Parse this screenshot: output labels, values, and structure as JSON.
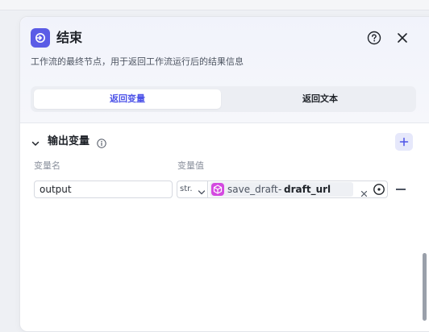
{
  "node": {
    "title": "结束",
    "description": "工作流的最终节点，用于返回工作流运行后的结果信息"
  },
  "tabs": [
    {
      "label": "返回变量",
      "active": true
    },
    {
      "label": "返回文本",
      "active": false
    }
  ],
  "output_section": {
    "title": "输出变量",
    "columns": {
      "name": "变量名",
      "value": "变量值"
    },
    "rows": [
      {
        "name": "output",
        "type": "str.",
        "ref_node": "save_draft",
        "ref_sep": "-",
        "ref_field": "draft_url"
      }
    ]
  },
  "colors": {
    "accent": "#4d53e8",
    "node_icon": "#5b5ce6",
    "ref_icon": "#d449e0"
  },
  "icons": {
    "node": "end-node-icon",
    "help": "help-icon",
    "close": "close-icon",
    "collapse": "chevron-down-icon",
    "info": "info-icon",
    "add": "plus-icon",
    "ref": "cube-icon",
    "clear": "clear-icon",
    "target": "target-icon",
    "remove": "minus-icon"
  }
}
